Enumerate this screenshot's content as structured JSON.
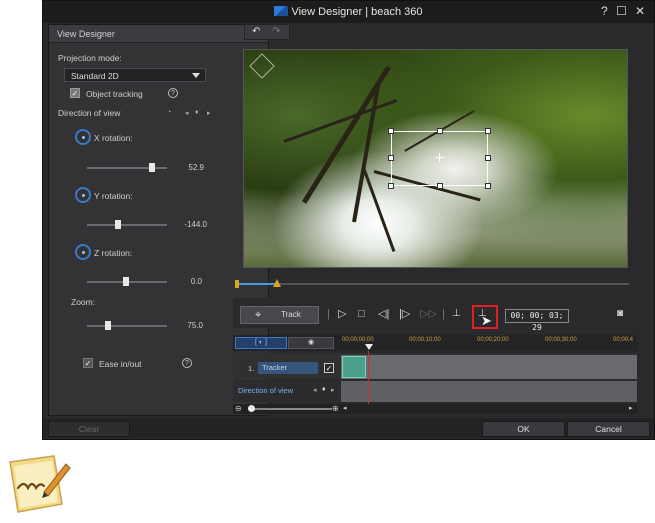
{
  "window": {
    "title": "View Designer  |  beach 360",
    "controls": {
      "help": "?",
      "maximize": "☐",
      "close": "✕"
    }
  },
  "left_panel": {
    "header": "View Designer",
    "projection_label": "Projection mode:",
    "projection_value": "Standard 2D",
    "object_tracking_label": "Object tracking",
    "object_tracking_checked": true,
    "direction_label": "Direction of view",
    "x_rotation": {
      "label": "X rotation:",
      "value": "52.9",
      "slider": 0.8
    },
    "y_rotation": {
      "label": "Y rotation:",
      "value": "-144.0",
      "slider": 0.3
    },
    "z_rotation": {
      "label": "Z rotation:",
      "value": "0.0",
      "slider": 0.5
    },
    "zoom": {
      "label": "Zoom:",
      "value": "75.0",
      "slider": 0.25
    },
    "ease_label": "Ease in/out",
    "ease_checked": true
  },
  "preview": {
    "undo": "↶",
    "redo": "↷"
  },
  "controls": {
    "track_label": "Track",
    "timecode": "00; 00; 03; 29",
    "scrub_progress": 0.1
  },
  "timeline": {
    "ruler_labels": [
      "00;00;00;00",
      "00;00;10;00",
      "00;00;20;00",
      "00;00;30;00",
      "00;00;4"
    ],
    "tracker_index": "1.",
    "tracker_name": "Tracker",
    "direction_row": "Direction of view"
  },
  "footer": {
    "clear": "Clear",
    "ok": "OK",
    "cancel": "Cancel"
  },
  "colors": {
    "accent": "#3a78c8",
    "highlight": "#e02020",
    "clip": "#4aa08a"
  },
  "note_icon": "note"
}
